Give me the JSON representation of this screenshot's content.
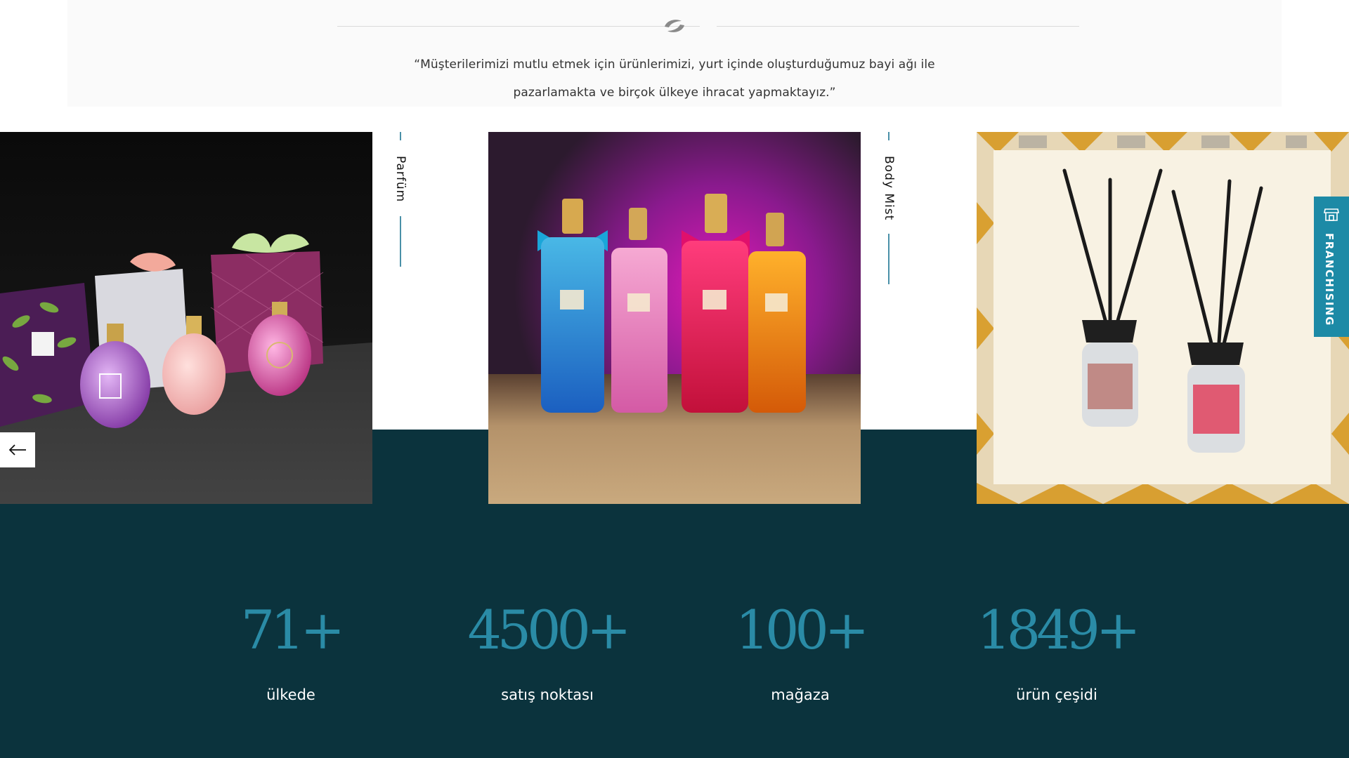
{
  "quote": {
    "line1": "“Müşterilerimizi mutlu etmek için ürünlerimizi, yurt içinde oluşturduğumuz bayi ağı ile",
    "line2": "pazarlamakta ve birçok ülkeye ihracat yapmaktayız.”"
  },
  "slider": {
    "labels": [
      "Parfüm",
      "Body Mist"
    ],
    "accent_color": "#4a90a8"
  },
  "stats": [
    {
      "value": "71+",
      "label": "ülkede"
    },
    {
      "value": "4500+",
      "label": "satış noktası"
    },
    {
      "value": "100+",
      "label": "mağaza"
    },
    {
      "value": "1849+",
      "label": "ürün çeşidi"
    }
  ],
  "franchise": {
    "label": "FRANCHISING",
    "icon": "store-icon"
  },
  "colors": {
    "stats_background": "#0b333d",
    "stats_number": "#2a8ba6",
    "franchise_tab": "#1d8aa6"
  }
}
